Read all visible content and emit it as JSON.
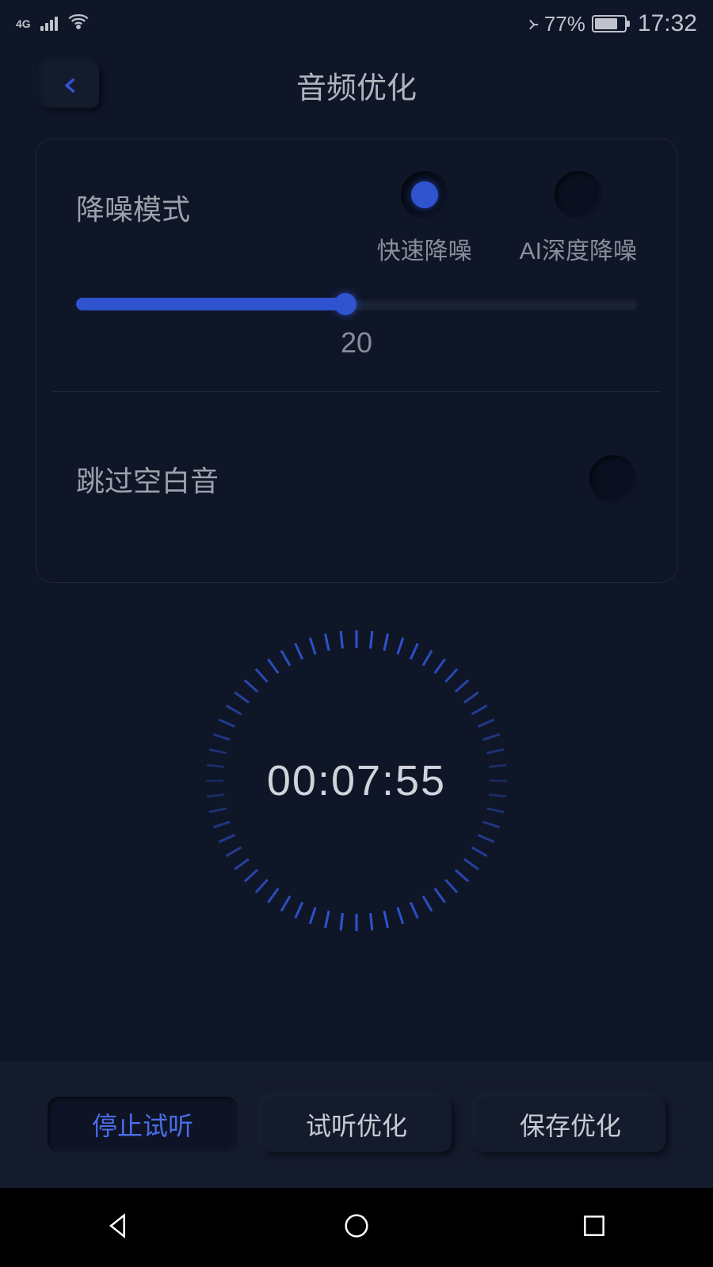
{
  "statusBar": {
    "network": "4G",
    "batteryPercent": "77%",
    "time": "17:32"
  },
  "header": {
    "title": "音频优化"
  },
  "noiseMode": {
    "label": "降噪模式",
    "options": {
      "fast": "快速降噪",
      "ai": "AI深度降噪"
    },
    "sliderValue": "20"
  },
  "skipSilence": {
    "label": "跳过空白音"
  },
  "timer": {
    "display": "00:07:55"
  },
  "buttons": {
    "stopPreview": "停止试听",
    "previewOptimize": "试听优化",
    "saveOptimize": "保存优化"
  }
}
